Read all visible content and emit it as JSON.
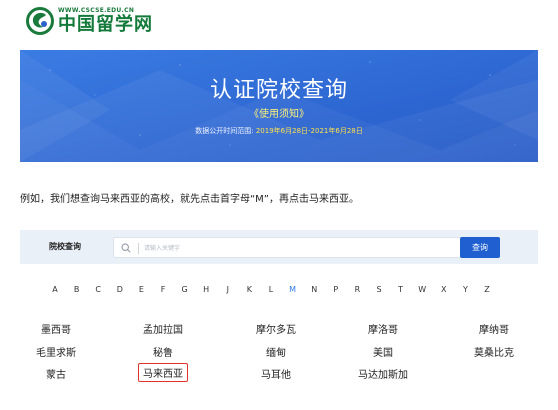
{
  "logo": {
    "url": "WWW.CSCSE.EDU.CN",
    "name": "中国留学网",
    "icon": "cscse-logo-icon"
  },
  "banner": {
    "title": "认证院校查询",
    "note": "《使用须知》",
    "range_label": "数据公开时间范围:",
    "range_value": "2019年6月28日-2021年6月28日"
  },
  "instruction": "例如，我们想查询马来西亚的高校，就先点击首字母“M”，再点击马来西亚。",
  "search": {
    "label": "院校查询",
    "placeholder": "请输入关键字",
    "value": "",
    "button": "查询",
    "icon": "search-icon"
  },
  "letters": [
    "A",
    "B",
    "C",
    "D",
    "E",
    "F",
    "G",
    "H",
    "J",
    "K",
    "L",
    "M",
    "N",
    "P",
    "R",
    "S",
    "T",
    "W",
    "X",
    "Y",
    "Z"
  ],
  "active_letter": "M",
  "countries": [
    [
      "墨西哥",
      "孟加拉国",
      "摩尔多瓦",
      "摩洛哥",
      "摩纳哥"
    ],
    [
      "毛里求斯",
      "秘鲁",
      "缅甸",
      "美国",
      "莫桑比克"
    ],
    [
      "蒙古",
      "马来西亚",
      "马耳他",
      "马达加斯加"
    ]
  ],
  "highlighted_country": "马来西亚",
  "colors": {
    "banner_blue": "#2f6fd8",
    "button_blue": "#1f5fd0",
    "active_letter": "#2f7be6",
    "highlight_red": "#e0322a",
    "logo_green": "#137a3a"
  }
}
